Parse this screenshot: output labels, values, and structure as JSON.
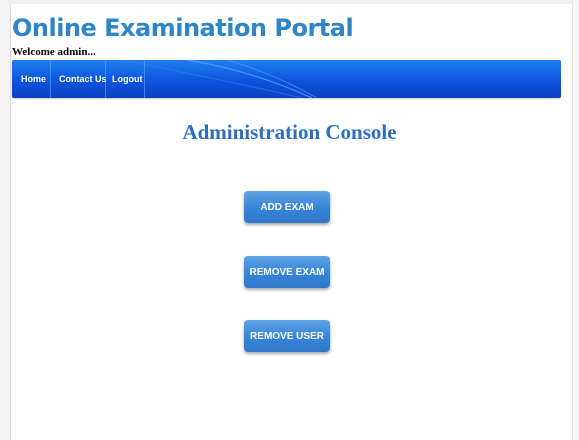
{
  "header": {
    "title": "Online Examination Portal",
    "welcome": "Welcome admin..."
  },
  "nav": {
    "items": [
      {
        "label": "Home"
      },
      {
        "label": "Contact Us"
      },
      {
        "label": "Logout"
      }
    ]
  },
  "main": {
    "heading": "Administration Console",
    "buttons": {
      "add_exam": "ADD EXAM",
      "remove_exam": "REMOVE EXAM",
      "remove_user": "REMOVE USER"
    }
  },
  "colors": {
    "title": "#2e86c8",
    "navbar": "#0c54de",
    "heading": "#2c6ec2",
    "button": "#3584d8"
  }
}
